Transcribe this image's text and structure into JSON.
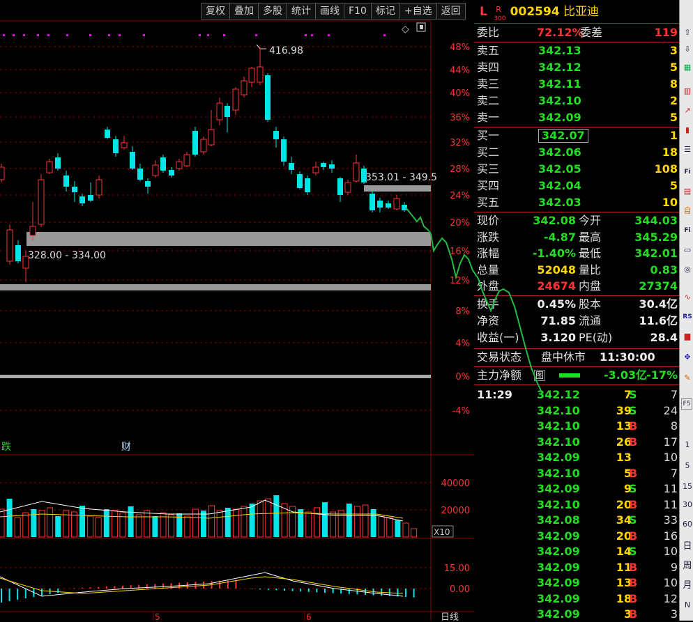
{
  "toolbar": [
    "复权",
    "叠加",
    "多股",
    "统计",
    "画线",
    "F10",
    "标记",
    "+自选",
    "返回"
  ],
  "chart": {
    "pct_ticks": [
      "48%",
      "44%",
      "40%",
      "36%",
      "32%",
      "28%",
      "24%",
      "20%",
      "16%",
      "12%",
      "8%",
      "4%",
      "0%",
      "-4%"
    ],
    "high_label": "416.98",
    "zone_upper_label": "353.01 - 349.5",
    "zone_lower_label": "328.00 - 334.00",
    "marker_fall": "跌",
    "marker_fin": "财",
    "vol_ticks": [
      "40000",
      "20000"
    ],
    "vol_unit": "X10",
    "macd_ticks": [
      "15.00",
      "0.00"
    ],
    "date_labels": [
      "5",
      "6"
    ],
    "period": "日线",
    "colors": {
      "up": "#ff3333",
      "down": "#00e5e5",
      "ma1": "#ffffff",
      "ma2": "#ffd700",
      "grid": "#8b0000",
      "zone": "#999999",
      "forecast": "#22bb44"
    }
  },
  "quote": {
    "header": {
      "market": "L",
      "badge_top": "R",
      "badge_bottom": "300",
      "code": "002594",
      "name": "比亚迪"
    },
    "weibi": {
      "label": "委比",
      "value": "72.12%",
      "label2": "委差",
      "value2": "119"
    },
    "sells": [
      {
        "label": "卖五",
        "price": "342.13",
        "vol": "3"
      },
      {
        "label": "卖四",
        "price": "342.12",
        "vol": "5"
      },
      {
        "label": "卖三",
        "price": "342.11",
        "vol": "8"
      },
      {
        "label": "卖二",
        "price": "342.10",
        "vol": "2"
      },
      {
        "label": "卖一",
        "price": "342.09",
        "vol": "5"
      }
    ],
    "buys": [
      {
        "label": "买一",
        "price": "342.07",
        "vol": "1"
      },
      {
        "label": "买二",
        "price": "342.06",
        "vol": "18"
      },
      {
        "label": "买三",
        "price": "342.05",
        "vol": "108"
      },
      {
        "label": "买四",
        "price": "342.04",
        "vol": "5"
      },
      {
        "label": "买五",
        "price": "342.03",
        "vol": "10"
      }
    ],
    "stats": [
      {
        "l1": "现价",
        "v1": "342.08",
        "c1": "grn",
        "l2": "今开",
        "v2": "344.03",
        "c2": "grn"
      },
      {
        "l1": "涨跌",
        "v1": "-4.87",
        "c1": "grn",
        "l2": "最高",
        "v2": "345.29",
        "c2": "grn"
      },
      {
        "l1": "涨幅",
        "v1": "-1.40%",
        "c1": "grn",
        "l2": "最低",
        "v2": "342.01",
        "c2": "grn"
      },
      {
        "l1": "总量",
        "v1": "52048",
        "c1": "yel",
        "l2": "量比",
        "v2": "0.83",
        "c2": "grn"
      },
      {
        "l1": "外盘",
        "v1": "24674",
        "c1": "red",
        "l2": "内盘",
        "v2": "27374",
        "c2": "grn"
      }
    ],
    "stats2": [
      {
        "l1": "换手",
        "v1": "0.45%",
        "l2": "股本",
        "v2": "30.4亿"
      },
      {
        "l1": "净资",
        "v1": "71.85",
        "l2": "流通",
        "v2": "11.6亿"
      },
      {
        "l1": "收益(一)",
        "v1": "3.120",
        "l2": "PE(动)",
        "v2": "28.4"
      }
    ],
    "trade_status": {
      "label": "交易状态",
      "value": "盘中休市",
      "time": "11:30:00"
    },
    "main_net": {
      "label": "主力净额",
      "icon": "图",
      "value": "-3.03亿",
      "pct": "-17%"
    },
    "ticks_time": "11:29",
    "ticks": [
      {
        "price": "342.12",
        "vol": "7",
        "side": "S",
        "n": "7"
      },
      {
        "price": "342.10",
        "vol": "39",
        "side": "S",
        "n": "24"
      },
      {
        "price": "342.10",
        "vol": "13",
        "side": "B",
        "n": "8"
      },
      {
        "price": "342.10",
        "vol": "26",
        "side": "B",
        "n": "17"
      },
      {
        "price": "342.09",
        "vol": "13",
        "side": "",
        "n": "10"
      },
      {
        "price": "342.10",
        "vol": "5",
        "side": "B",
        "n": "7"
      },
      {
        "price": "342.09",
        "vol": "9",
        "side": "S",
        "n": "11"
      },
      {
        "price": "342.10",
        "vol": "20",
        "side": "B",
        "n": "11"
      },
      {
        "price": "342.08",
        "vol": "34",
        "side": "S",
        "n": "33"
      },
      {
        "price": "342.09",
        "vol": "20",
        "side": "B",
        "n": "16"
      },
      {
        "price": "342.09",
        "vol": "14",
        "side": "S",
        "n": "10"
      },
      {
        "price": "342.09",
        "vol": "11",
        "side": "B",
        "n": "9"
      },
      {
        "price": "342.09",
        "vol": "13",
        "side": "B",
        "n": "10"
      },
      {
        "price": "342.09",
        "vol": "18",
        "side": "B",
        "n": "12"
      },
      {
        "price": "342.09",
        "vol": "3",
        "side": "B",
        "n": "3"
      }
    ]
  },
  "sidebar_icons": [
    "Fi",
    "Fi",
    "RS",
    "F5",
    "1",
    "5",
    "15",
    "30",
    "60",
    "日",
    "周",
    "月",
    "N"
  ]
}
